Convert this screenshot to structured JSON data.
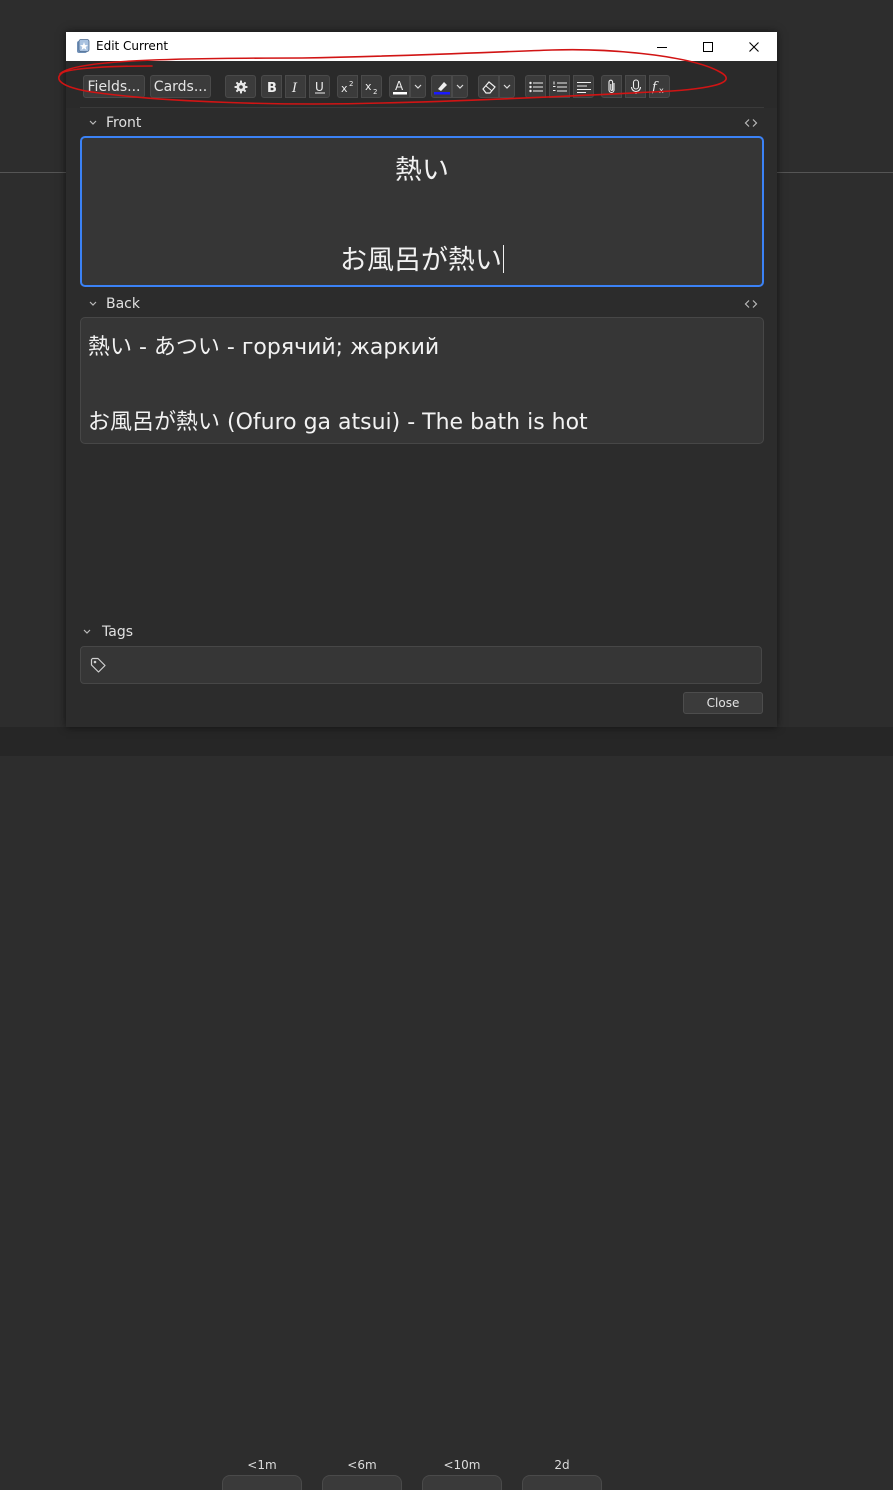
{
  "window": {
    "title": "Edit Current"
  },
  "toolbar": {
    "fields_label": "Fields...",
    "cards_label": "Cards...",
    "icons": [
      "gear-icon",
      "bold-icon",
      "italic-icon",
      "underline-icon",
      "superscript-icon",
      "subscript-icon",
      "text-color-icon",
      "highlight-icon",
      "eraser-icon",
      "bullet-list-icon",
      "numbered-list-icon",
      "align-icon",
      "attachment-icon",
      "microphone-icon",
      "function-icon"
    ],
    "text_color": "#ffffff",
    "highlight_color": "#1a1aff"
  },
  "fields": {
    "front": {
      "label": "Front",
      "line1": "熱い",
      "line2": "お風呂が熱い"
    },
    "back": {
      "label": "Back",
      "line1": "熱い - あつい - горячий; жаркий",
      "line2": "お風呂が熱い (Ofuro ga atsui) - The bath is hot"
    }
  },
  "tags": {
    "label": "Tags",
    "value": ""
  },
  "buttons": {
    "close_label": "Close"
  },
  "background": {
    "ease_labels": [
      "<1m",
      "<6m",
      "<10m",
      "2d"
    ]
  },
  "colors": {
    "focus_border": "#3b82f6",
    "annotation": "#d11414"
  }
}
